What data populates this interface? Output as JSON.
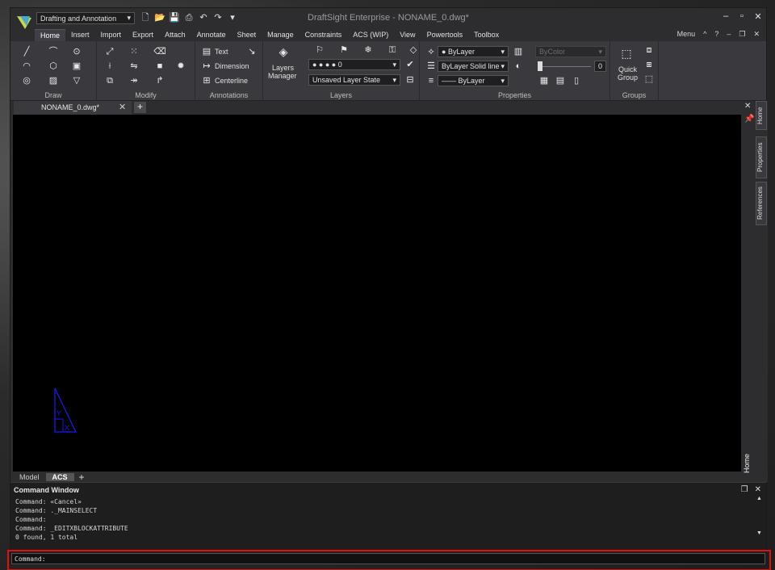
{
  "window": {
    "title": "DraftSight Enterprise - NONAME_0.dwg*",
    "workspace": "Drafting and Annotation"
  },
  "menu": {
    "tabs": [
      "Home",
      "Insert",
      "Import",
      "Export",
      "Attach",
      "Annotate",
      "Sheet",
      "Manage",
      "Constraints",
      "ACS (WIP)",
      "View",
      "Powertools",
      "Toolbox"
    ],
    "right": [
      "Menu",
      "^",
      "?"
    ]
  },
  "ribbon": {
    "groups": {
      "draw": "Draw",
      "modify": "Modify",
      "annotations": "Annotations",
      "layers": "Layers",
      "properties": "Properties",
      "groups": "Groups"
    },
    "annotations": {
      "text": "Text",
      "dimension": "Dimension",
      "centerline": "Centerline"
    },
    "layers": {
      "manager_line1": "Layers",
      "manager_line2": "Manager",
      "layer_value": "0",
      "layer_state": "Unsaved Layer State"
    },
    "properties": {
      "color": "ByLayer",
      "linetype_layer": "ByLayer",
      "linetype": "Solid line",
      "lineweight": "—— ByLayer",
      "bycolor": "ByColor",
      "transparency": "0"
    },
    "groups_panel": {
      "quick_line1": "Quick",
      "quick_line2": "Group"
    }
  },
  "document": {
    "tab": "NONAME_0.dwg*"
  },
  "model_tabs": [
    "Model",
    "ACS"
  ],
  "side_tabs": [
    "Home",
    "Properties",
    "References"
  ],
  "side_home": "Home",
  "command": {
    "title": "Command Window",
    "history": [
      "Command: «Cancel»",
      "Command: ._MAINSELECT",
      "Command:",
      "Command: _EDITXBLOCKATTRIBUTE",
      "0 found, 1 total"
    ],
    "prompt": "Command:"
  },
  "colors": {
    "accent_highlight": "#e01010",
    "canvas": "#000000",
    "ucs": "#1a1aff"
  }
}
